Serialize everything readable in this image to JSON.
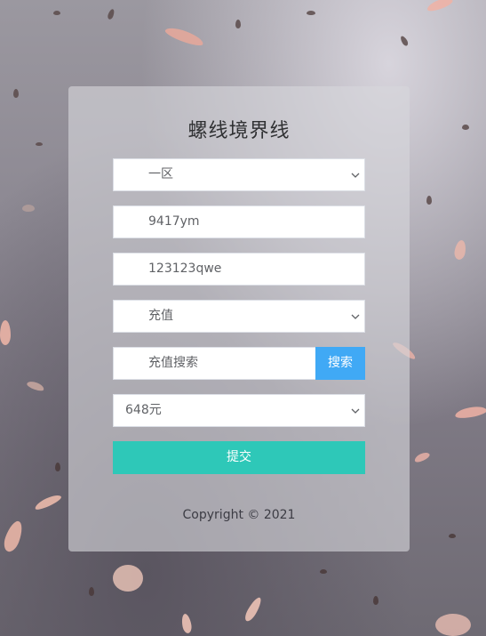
{
  "app": {
    "title": "螺线境界线"
  },
  "form": {
    "region_select": {
      "value": "一区"
    },
    "account_field": {
      "value": "9417ym"
    },
    "password_field": {
      "value": "123123qwe"
    },
    "type_select": {
      "value": "充值"
    },
    "search": {
      "placeholder": "充值搜索",
      "button_label": "搜索"
    },
    "amount_select": {
      "value": "648元"
    },
    "submit_label": "提交"
  },
  "footer": {
    "copyright": "Copyright © 2021"
  },
  "colors": {
    "search_button": "#40a9f5",
    "submit_button": "#2ec8b8",
    "panel": "rgba(215,215,220,0.62)"
  }
}
